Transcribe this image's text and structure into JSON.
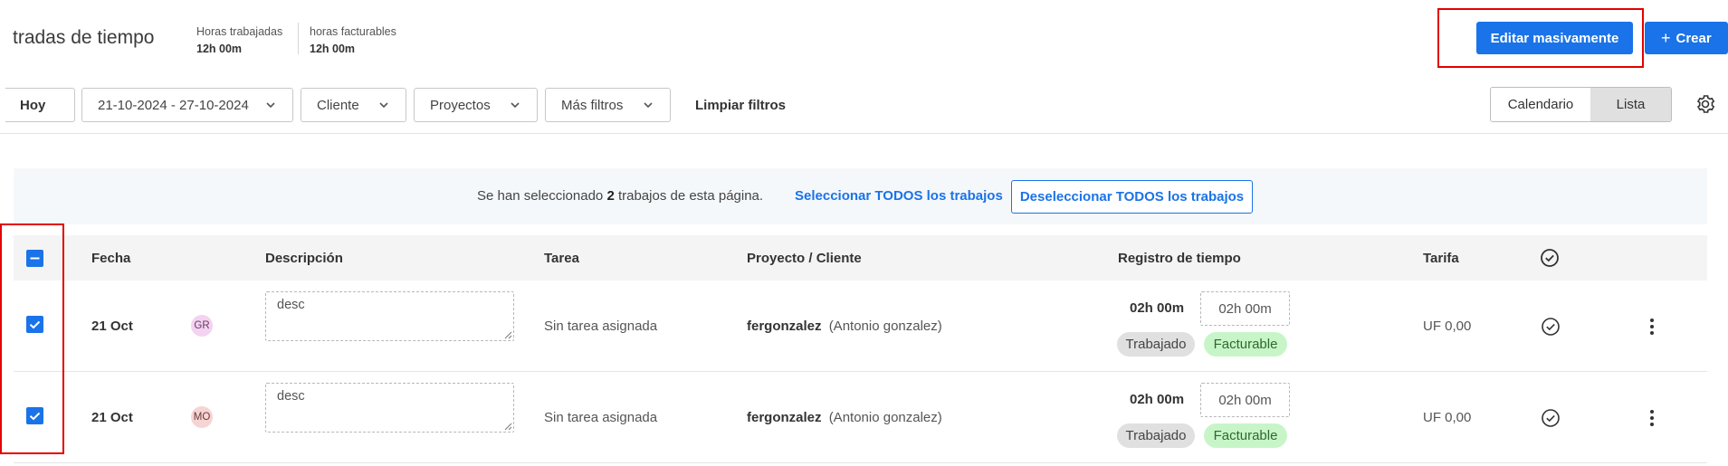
{
  "header": {
    "title": "tradas de tiempo",
    "stats": [
      {
        "label": "Horas trabajadas",
        "value": "12h 00m"
      },
      {
        "label": "horas facturables",
        "value": "12h 00m"
      }
    ],
    "bulk_edit_label": "Editar masivamente",
    "create_label": "Crear",
    "create_icon": "plus-icon"
  },
  "filters": {
    "today": "Hoy",
    "date_range": "21-10-2024 - 27-10-2024",
    "client": "Cliente",
    "projects": "Proyectos",
    "more_filters": "Más filtros",
    "clear": "Limpiar filtros",
    "views": {
      "calendar": "Calendario",
      "list": "Lista",
      "active": "list"
    },
    "settings_icon": "gear-icon"
  },
  "banner": {
    "text_before": "Se han seleccionado ",
    "count": "2",
    "text_after": " trabajos de esta página.",
    "select_all": "Seleccionar TODOS los trabajos",
    "deselect_all": "Deseleccionar TODOS los trabajos"
  },
  "table": {
    "columns": {
      "date": "Fecha",
      "description": "Descripción",
      "task": "Tarea",
      "project": "Proyecto / Cliente",
      "time": "Registro de tiempo",
      "rate": "Tarifa",
      "status_icon": "check-circle-icon"
    },
    "rows": [
      {
        "checked": true,
        "date": "21 Oct",
        "avatar": "GR",
        "description": "desc",
        "task": "Sin tarea asignada",
        "project": "fergonzalez",
        "client": "(Antonio gonzalez)",
        "time": "02h 00m",
        "time_input": "02h 00m",
        "badges": {
          "worked": "Trabajado",
          "billable": "Facturable"
        },
        "rate": "UF 0,00"
      },
      {
        "checked": true,
        "date": "21 Oct",
        "avatar": "MO",
        "description": "desc",
        "task": "Sin tarea asignada",
        "project": "fergonzalez",
        "client": "(Antonio gonzalez)",
        "time": "02h 00m",
        "time_input": "02h 00m",
        "badges": {
          "worked": "Trabajado",
          "billable": "Facturable"
        },
        "rate": "UF 0,00"
      }
    ]
  },
  "colors": {
    "primary": "#1a73e8",
    "highlight": "#e30000",
    "billable_bg": "#c8f5c8",
    "worked_bg": "#e0e0e0"
  }
}
